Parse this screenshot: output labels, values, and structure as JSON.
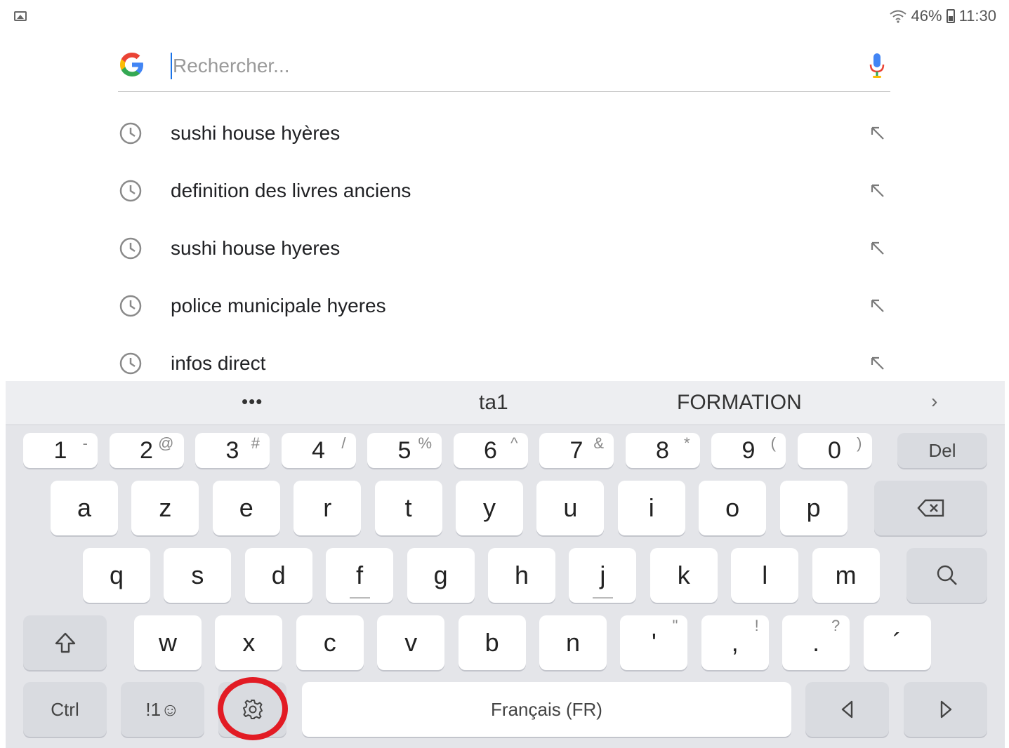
{
  "status_bar": {
    "left_icon": "image-notification-icon",
    "wifi_icon": "wifi-icon",
    "battery_percent": "46%",
    "battery_icon": "battery-icon",
    "time": "11:30"
  },
  "search": {
    "logo": "google-g-icon",
    "placeholder": "Rechercher...",
    "value": "",
    "mic_icon": "microphone-icon"
  },
  "suggestions": [
    {
      "text": "sushi house hyères",
      "icon": "history-clock-icon",
      "fill_icon": "arrow-up-left-icon"
    },
    {
      "text": "definition des livres anciens",
      "icon": "history-clock-icon",
      "fill_icon": "arrow-up-left-icon"
    },
    {
      "text": "sushi house hyeres",
      "icon": "history-clock-icon",
      "fill_icon": "arrow-up-left-icon"
    },
    {
      "text": "police municipale hyeres",
      "icon": "history-clock-icon",
      "fill_icon": "arrow-up-left-icon"
    },
    {
      "text": "infos direct",
      "icon": "history-clock-icon",
      "fill_icon": "arrow-up-left-icon"
    }
  ],
  "keyboard": {
    "prediction": {
      "more": "•••",
      "words": [
        "ta1",
        "FORMATION"
      ],
      "expand": "›"
    },
    "number_row": [
      {
        "main": "1",
        "sub": "-"
      },
      {
        "main": "2",
        "sub": "@"
      },
      {
        "main": "3",
        "sub": "#"
      },
      {
        "main": "4",
        "sub": "/"
      },
      {
        "main": "5",
        "sub": "%"
      },
      {
        "main": "6",
        "sub": "^"
      },
      {
        "main": "7",
        "sub": "&"
      },
      {
        "main": "8",
        "sub": "*"
      },
      {
        "main": "9",
        "sub": "("
      },
      {
        "main": "0",
        "sub": ")"
      }
    ],
    "del_label": "Del",
    "row1": [
      "a",
      "z",
      "e",
      "r",
      "t",
      "y",
      "u",
      "i",
      "o",
      "p"
    ],
    "backspace_icon": "backspace-icon",
    "row2": [
      "q",
      "s",
      "d",
      "f",
      "g",
      "h",
      "j",
      "k",
      "l",
      "m"
    ],
    "search_key_icon": "search-icon",
    "shift_icon": "shift-icon",
    "row3": [
      {
        "main": "w",
        "sub": ""
      },
      {
        "main": "x",
        "sub": ""
      },
      {
        "main": "c",
        "sub": ""
      },
      {
        "main": "v",
        "sub": ""
      },
      {
        "main": "b",
        "sub": ""
      },
      {
        "main": "n",
        "sub": ""
      },
      {
        "main": "'",
        "sub": "\""
      },
      {
        "main": ",",
        "sub": "!"
      },
      {
        "main": ".",
        "sub": "?"
      },
      {
        "main": "´",
        "sub": ""
      }
    ],
    "ctrl_label": "Ctrl",
    "symbols_label": "!1☺",
    "settings_icon": "gear-icon",
    "space_label": "Français (FR)",
    "left_icon": "left-arrow-icon",
    "right_icon": "right-arrow-icon",
    "highlight_color": "#e21b24"
  }
}
